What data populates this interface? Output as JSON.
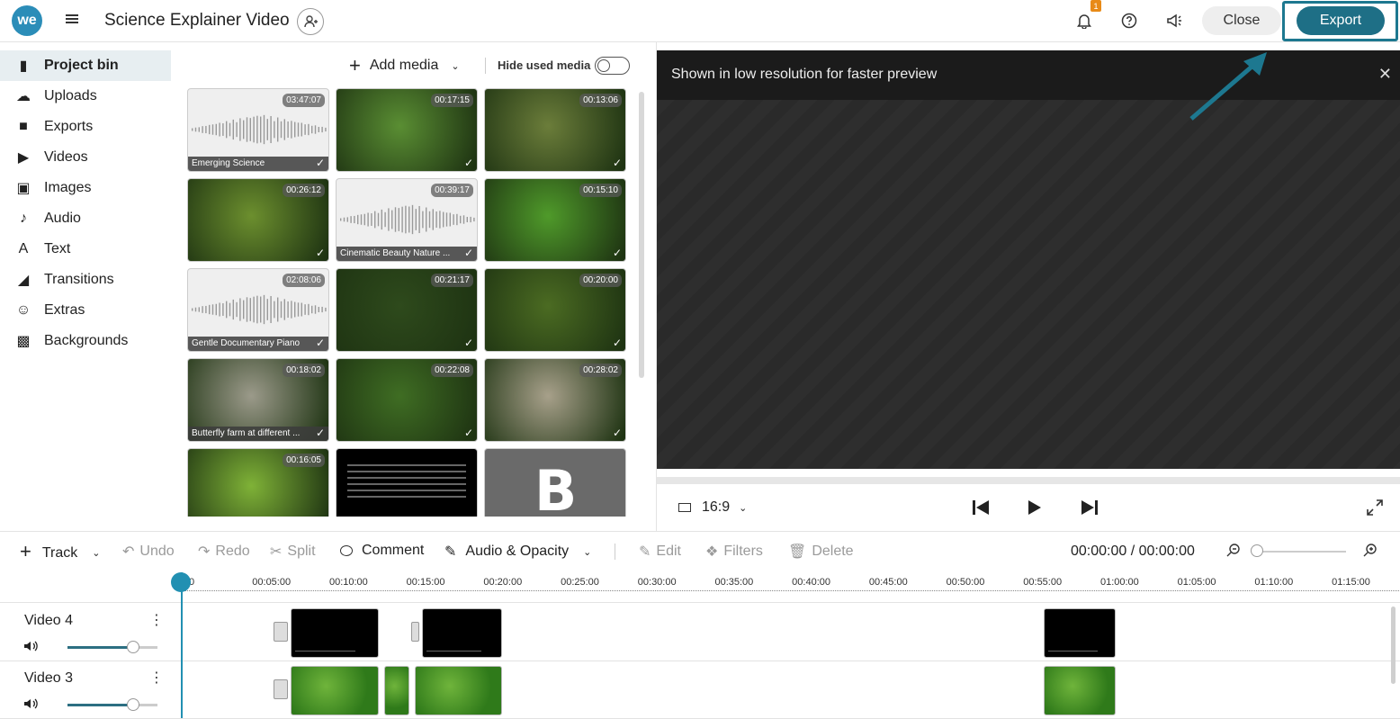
{
  "header": {
    "logo_text": "we",
    "project_title": "Science Explainer Video",
    "notification_count": "1",
    "close_label": "Close",
    "export_label": "Export"
  },
  "sidebar": {
    "items": [
      {
        "label": "Project bin",
        "icon": "bin-icon",
        "active": true
      },
      {
        "label": "Uploads",
        "icon": "cloud-upload-icon"
      },
      {
        "label": "Exports",
        "icon": "video-camera-icon"
      },
      {
        "label": "Videos",
        "icon": "play-box-icon"
      },
      {
        "label": "Images",
        "icon": "image-icon"
      },
      {
        "label": "Audio",
        "icon": "music-note-icon"
      },
      {
        "label": "Text",
        "icon": "text-icon"
      },
      {
        "label": "Transitions",
        "icon": "transition-icon"
      },
      {
        "label": "Extras",
        "icon": "smiley-icon"
      },
      {
        "label": "Backgrounds",
        "icon": "backgrounds-icon"
      }
    ]
  },
  "bin": {
    "add_media_label": "Add media",
    "hide_used_label": "Hide used media",
    "items": [
      {
        "type": "audio",
        "duration": "03:47:07",
        "caption": "Emerging Science",
        "used": true
      },
      {
        "type": "video",
        "duration": "00:17:15",
        "caption": "",
        "used": true,
        "color": "#5a8e33"
      },
      {
        "type": "video",
        "duration": "00:13:06",
        "caption": "",
        "used": true,
        "color": "#6b7d3a"
      },
      {
        "type": "video",
        "duration": "00:26:12",
        "caption": "",
        "used": true,
        "color": "#6c8f2e"
      },
      {
        "type": "audio",
        "duration": "00:39:17",
        "caption": "Cinematic Beauty Nature ...",
        "used": true
      },
      {
        "type": "video",
        "duration": "00:15:10",
        "caption": "",
        "used": true,
        "color": "#4f9a2a"
      },
      {
        "type": "audio",
        "duration": "02:08:06",
        "caption": "Gentle Documentary Piano",
        "used": true
      },
      {
        "type": "video",
        "duration": "00:21:17",
        "caption": "",
        "used": true,
        "color": "#2e4a1c"
      },
      {
        "type": "video",
        "duration": "00:20:00",
        "caption": "",
        "used": true,
        "color": "#4b6b22"
      },
      {
        "type": "video",
        "duration": "00:18:02",
        "caption": "Butterfly farm at different ...",
        "used": true,
        "color": "#9b9a8a"
      },
      {
        "type": "video",
        "duration": "00:22:08",
        "caption": "",
        "used": true,
        "color": "#3f6d23"
      },
      {
        "type": "video",
        "duration": "00:28:02",
        "caption": "",
        "used": true,
        "color": "#a7a08a"
      },
      {
        "type": "video",
        "duration": "00:16:05",
        "caption": "",
        "used": false,
        "color": "#7fb237"
      },
      {
        "type": "text",
        "duration": "",
        "caption": "",
        "used": false,
        "color": "#000000"
      },
      {
        "type": "logo",
        "duration": "",
        "caption": "",
        "used": false,
        "color": "#6a6a6a",
        "glyph": "B"
      }
    ]
  },
  "preview": {
    "notice": "Shown in low resolution for faster preview",
    "aspect_ratio": "16:9"
  },
  "toolbar": {
    "track_label": "Track",
    "undo_label": "Undo",
    "redo_label": "Redo",
    "split_label": "Split",
    "comment_label": "Comment",
    "audio_opacity_label": "Audio & Opacity",
    "edit_label": "Edit",
    "filters_label": "Filters",
    "delete_label": "Delete",
    "time_readout": "00:00:00 / 00:00:00"
  },
  "timeline": {
    "ticks": [
      "00",
      "00:05:00",
      "00:10:00",
      "00:15:00",
      "00:20:00",
      "00:25:00",
      "00:30:00",
      "00:35:00",
      "00:40:00",
      "00:45:00",
      "00:50:00",
      "00:55:00",
      "01:00:00",
      "01:05:00",
      "01:10:00",
      "01:15:00"
    ],
    "tracks": [
      {
        "name": "Video 4",
        "volume": 0.73,
        "clip_style": "black"
      },
      {
        "name": "Video 3",
        "volume": 0.73,
        "clip_style": "green"
      }
    ]
  },
  "colors": {
    "accent": "#1e6f86",
    "playhead": "#2290b2",
    "badge": "#e88a17"
  }
}
